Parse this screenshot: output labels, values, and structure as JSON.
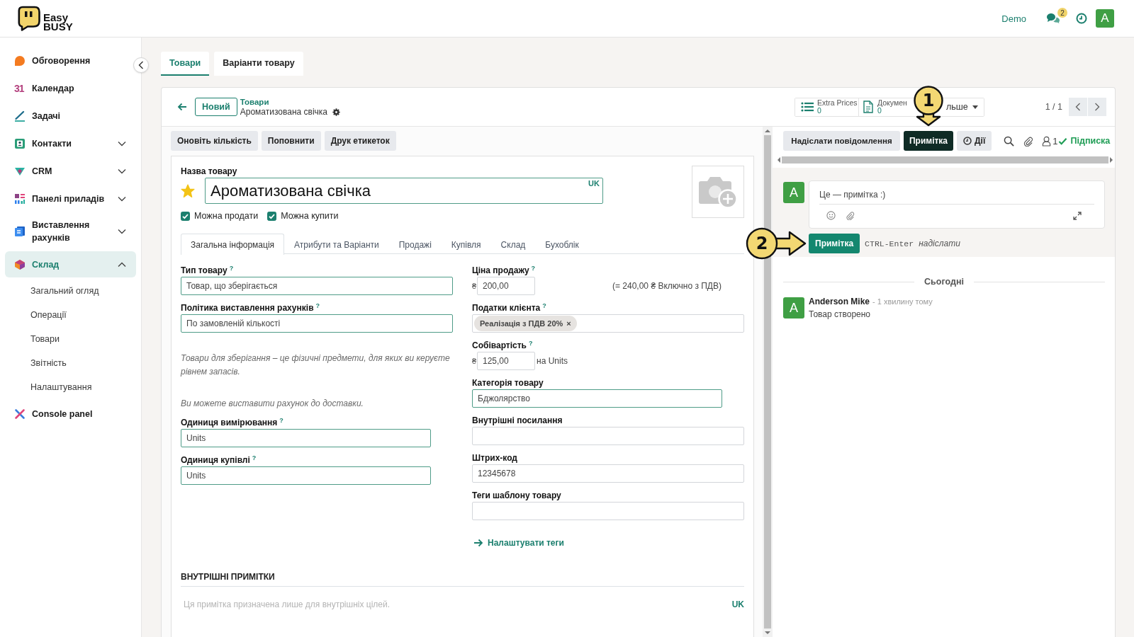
{
  "brand": {
    "lines": [
      "Easy",
      "BUSY"
    ]
  },
  "topbar": {
    "company": "Demo",
    "unread": "2",
    "avatar": "A"
  },
  "sidebar": {
    "items": [
      {
        "label": "Обговорення",
        "kind": "link",
        "selected": false
      },
      {
        "label": "Календар",
        "kind": "link",
        "selected": false,
        "glyph": "31"
      },
      {
        "label": "Задачі",
        "kind": "link",
        "selected": false
      },
      {
        "label": "Контакти",
        "kind": "menu",
        "selected": false,
        "expanded": false
      },
      {
        "label": "CRM",
        "kind": "menu",
        "selected": false,
        "expanded": false
      },
      {
        "label": "Панелі приладів",
        "kind": "menu",
        "selected": false,
        "expanded": false
      },
      {
        "label": "Виставлення рахунків",
        "kind": "menu",
        "selected": false,
        "expanded": false
      },
      {
        "label": "Склад",
        "kind": "menu",
        "selected": true,
        "expanded": true,
        "children": [
          {
            "label": "Загальний огляд",
            "selected": false
          },
          {
            "label": "Операції",
            "selected": false
          },
          {
            "label": "Товари",
            "selected": false
          },
          {
            "label": "Звітність",
            "selected": false
          },
          {
            "label": "Налаштування",
            "selected": false
          }
        ]
      },
      {
        "label": "Console panel",
        "kind": "link",
        "selected": false
      }
    ]
  },
  "view_tabs": [
    {
      "label": "Товари",
      "selected": true
    },
    {
      "label": "Варіанти товару",
      "selected": false
    }
  ],
  "control_panel": {
    "new_button": "Новий",
    "breadcrumb": "Товари",
    "record_title": "Ароматизована свічка",
    "smart_buttons": [
      {
        "kind": "stat",
        "label": "Extra Prices",
        "value": "0"
      },
      {
        "kind": "stat",
        "label": "Докумен",
        "value": "0"
      },
      {
        "kind": "more",
        "label": "льше"
      }
    ],
    "pager": "1 / 1"
  },
  "actions": [
    {
      "label": "Оновіть кількість"
    },
    {
      "label": "Поповнити"
    },
    {
      "label": "Друк етикеток"
    }
  ],
  "product": {
    "name_label": "Назва товару",
    "favorite": true,
    "name": "Ароматизована свічка",
    "required": true,
    "language": "UK",
    "options": [
      {
        "label": "Можна продати",
        "checked": true
      },
      {
        "label": "Можна купити",
        "checked": true
      }
    ]
  },
  "notebook_tabs": [
    {
      "label": "Загальна інформація",
      "selected": true
    },
    {
      "label": "Атрибути та Варіанти",
      "selected": false
    },
    {
      "label": "Продажі",
      "selected": false
    },
    {
      "label": "Купівля",
      "selected": false
    },
    {
      "label": "Склад",
      "selected": false
    },
    {
      "label": "Бухоблік",
      "selected": false
    }
  ],
  "general": {
    "left": [
      {
        "kind": "select",
        "label": "Тип товару",
        "help": "?",
        "value": "Товар, що зберігається",
        "required": true
      },
      {
        "kind": "select",
        "label": "Політика виставлення рахунків",
        "help": "?",
        "value": "По замовленій кількості",
        "required": true
      },
      {
        "kind": "note",
        "text": "Товари для зберігання – це фізичні предмети, для яких ви керуєте рівнем запасів."
      },
      {
        "kind": "note",
        "text": "Ви можете виставити рахунок до доставки."
      },
      {
        "kind": "many2one",
        "label": "Одиниця вимірювання",
        "help": "?",
        "value": "Units",
        "required": true
      },
      {
        "kind": "many2one",
        "label": "Одиниця купівлі",
        "help": "?",
        "value": "Units",
        "required": true
      }
    ],
    "right": [
      {
        "kind": "money",
        "label": "Ціна продажу",
        "help": "?",
        "currency": "₴",
        "value": "200,00",
        "note": "(= 240,00 ₴ Включно з ПДВ)",
        "required": false
      },
      {
        "kind": "tags",
        "label": "Податки клієнта",
        "help": "?",
        "tags": [
          {
            "label": "Реалізація з ПДВ 20%",
            "remove": "×"
          }
        ],
        "required": false
      },
      {
        "kind": "money",
        "label": "Собівартість",
        "help": "?",
        "currency": "₴",
        "value": "125,00",
        "suffix": "на Units",
        "required": false
      },
      {
        "kind": "many2one",
        "label": "Категорія товару",
        "value": "Бджолярство",
        "required": true
      },
      {
        "kind": "text",
        "label": "Внутрішні посилання",
        "required": false
      },
      {
        "kind": "text",
        "label": "Штрих-код",
        "value": "12345678",
        "required": false
      },
      {
        "kind": "text",
        "label": "Теги шаблону товару",
        "required": false
      },
      {
        "kind": "link",
        "text": "Налаштувати теги"
      }
    ]
  },
  "internal_notes": {
    "title": "ВНУТРІШНІ ПРИМІТКИ",
    "placeholder": "Ця примітка призначена лише для внутрішніх цілей.",
    "language": "UK"
  },
  "chatter": {
    "toolbar": [
      {
        "kind": "button",
        "label": "Надіслати повідомлення",
        "selected": false
      },
      {
        "kind": "button",
        "label": "Примітка",
        "selected": true,
        "callout": {
          "label": "1",
          "kind": "down"
        }
      },
      {
        "kind": "activity",
        "label": "Дії",
        "selected": false
      }
    ],
    "followers": "1",
    "follow": {
      "label": "Підписка",
      "following": true
    },
    "composer": {
      "avatar": "A",
      "value": "Це — примітка :)",
      "send": {
        "label": "Примітка",
        "callout": {
          "label": "2",
          "kind": "right"
        }
      },
      "shortcut": "CTRL-Enter",
      "shortcut_hint": "надіслати"
    },
    "date_separator": "Сьогодні",
    "messages": [
      {
        "avatar": "A",
        "author": "Anderson Mike",
        "time": "- 1 хвилину тому",
        "body": "Товар створено"
      }
    ]
  }
}
